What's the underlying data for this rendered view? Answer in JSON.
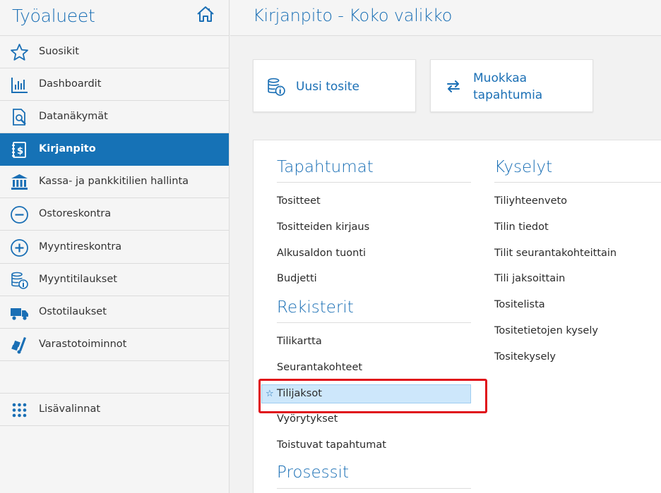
{
  "sidebar": {
    "title": "Työalueet",
    "items": [
      {
        "label": "Suosikit",
        "icon": "star-icon"
      },
      {
        "label": "Dashboardit",
        "icon": "bar-chart-icon"
      },
      {
        "label": "Datanäkymät",
        "icon": "document-search-icon"
      },
      {
        "label": "Kirjanpito",
        "icon": "ledger-dollar-icon",
        "active": true
      },
      {
        "label": "Kassa- ja pankkitilien hallinta",
        "icon": "bank-icon"
      },
      {
        "label": "Ostoreskontra",
        "icon": "minus-circle-icon"
      },
      {
        "label": "Myyntireskontra",
        "icon": "plus-circle-icon"
      },
      {
        "label": "Myyntitilaukset",
        "icon": "coins-info-icon"
      },
      {
        "label": "Ostotilaukset",
        "icon": "truck-icon"
      },
      {
        "label": "Varastotoiminnot",
        "icon": "dolly-icon"
      }
    ],
    "more": {
      "label": "Lisävalinnat",
      "icon": "grid-dots-icon"
    }
  },
  "header": {
    "title": "Kirjanpito - Koko valikko"
  },
  "tiles": [
    {
      "label": "Uusi tosite",
      "icon": "coins-info-icon"
    },
    {
      "label_line1": "Muokkaa",
      "label_line2": "tapahtumia",
      "icon": "swap-arrows-icon"
    }
  ],
  "sections": {
    "tapahtumat": {
      "title": "Tapahtumat",
      "links": [
        "Tositteet",
        "Tositteiden kirjaus",
        "Alkusaldon tuonti",
        "Budjetti"
      ]
    },
    "rekisterit": {
      "title": "Rekisterit",
      "links": [
        "Tilikartta",
        "Seurantakohteet",
        "Tilijaksot",
        "Vyörytykset",
        "Toistuvat tapahtumat"
      ]
    },
    "prosessit": {
      "title": "Prosessit"
    },
    "kyselyt": {
      "title": "Kyselyt",
      "links": [
        "Tiliyhteenveto",
        "Tilin tiedot",
        "Tilit seurantakohteittain",
        "Tili jaksoittain",
        "Tositelista",
        "Tositetietojen kysely",
        "Tositekysely"
      ]
    }
  },
  "colors": {
    "accent": "#1a6fb5",
    "active_bg": "#1672b6",
    "highlight_bg": "#cde7fb",
    "callout": "#e0101a"
  }
}
